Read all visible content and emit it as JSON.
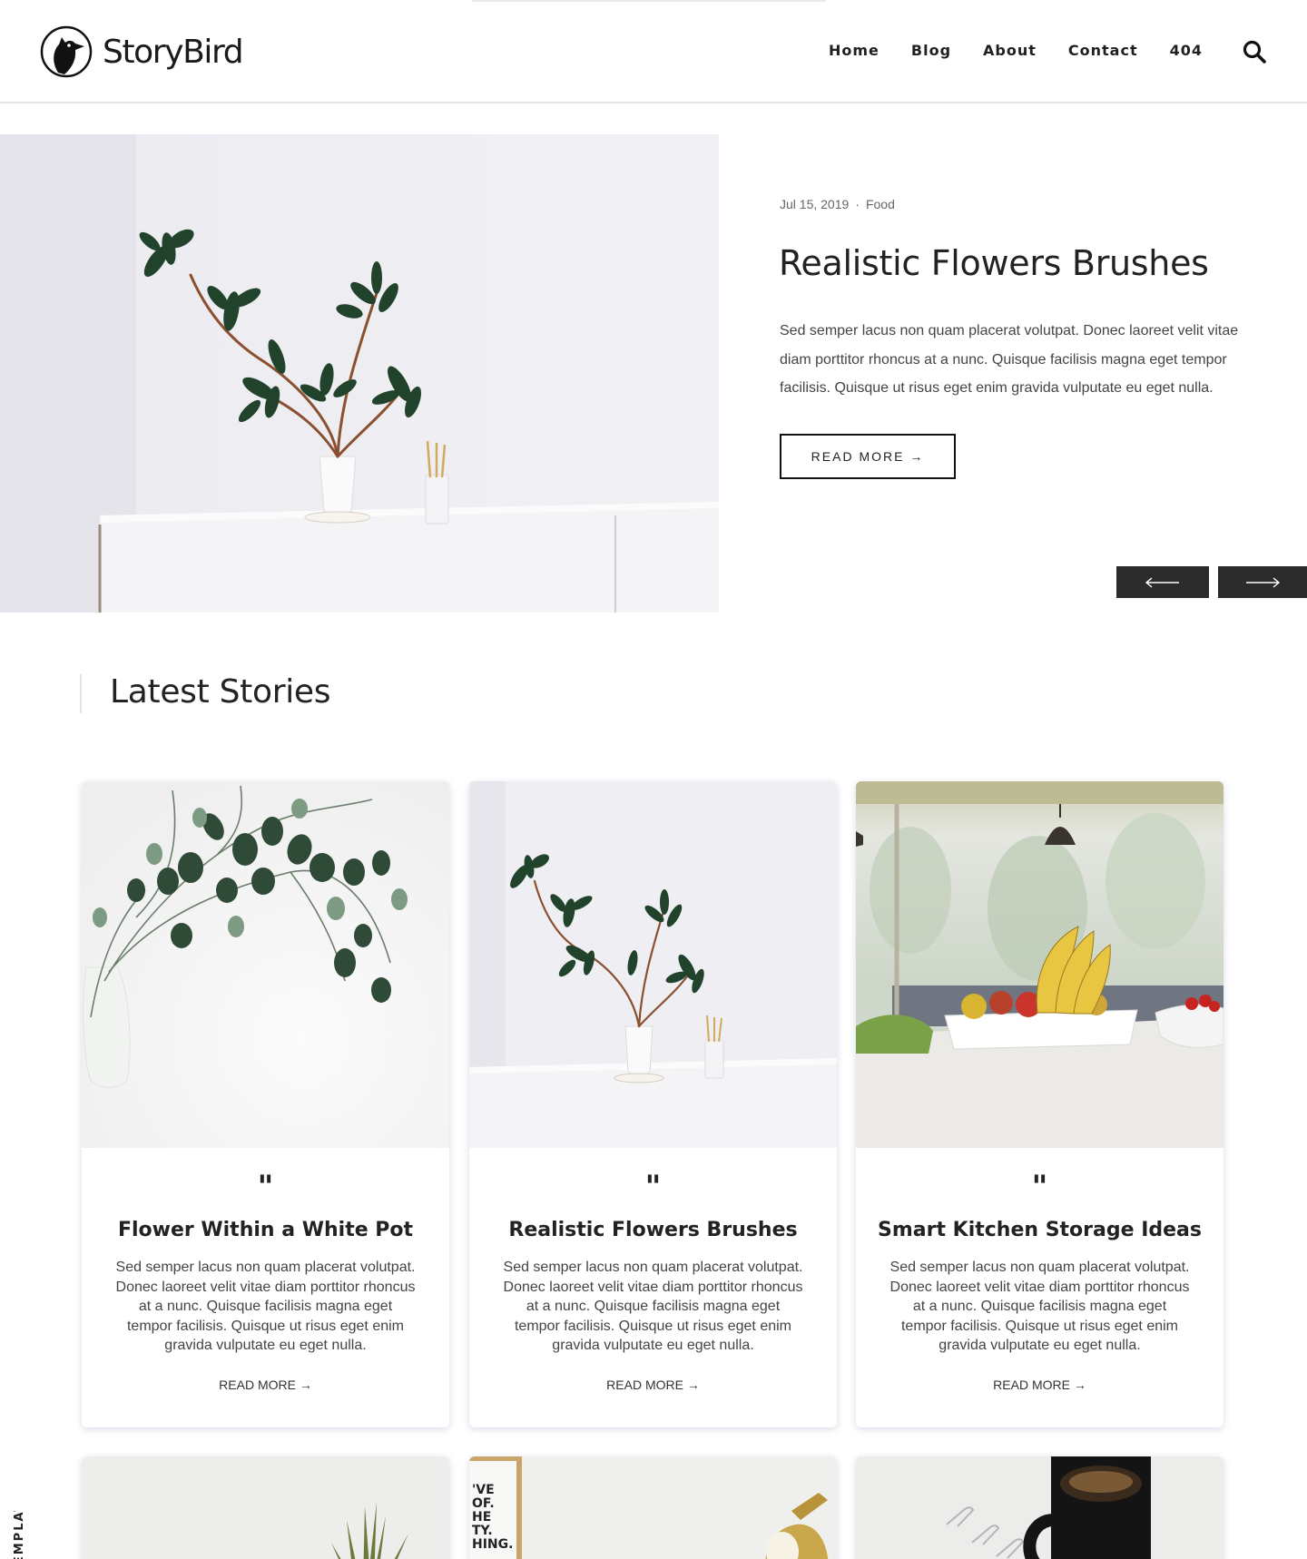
{
  "brand": {
    "name": "StoryBird"
  },
  "nav": {
    "items": [
      {
        "label": "Home"
      },
      {
        "label": "Blog"
      },
      {
        "label": "About"
      },
      {
        "label": "Contact"
      },
      {
        "label": "404"
      }
    ],
    "search_icon": "search-icon"
  },
  "hero": {
    "date": "Jul 15, 2019",
    "separator": "·",
    "category": "Food",
    "title": "Realistic Flowers Brushes",
    "excerpt": "Sed semper lacus non quam placerat volutpat. Donec laoreet velit vitae diam porttitor rhoncus at a nunc. Quisque facilisis magna eget tempor facilisis. Quisque ut risus eget enim gravida vulputate eu eget nulla.",
    "read_more": "READ MORE →",
    "prev_icon": "arrow-left-icon",
    "next_icon": "arrow-right-icon"
  },
  "latest": {
    "heading": "Latest Stories",
    "cards": [
      {
        "quote": "\"",
        "title": "Flower Within a White Pot",
        "excerpt": "Sed semper lacus non quam placerat volutpat. Donec laoreet velit vitae diam porttitor rhoncus at a nunc. Quisque facilisis magna eget tempor facilisis. Quisque ut risus eget enim gravida vulputate eu eget nulla.",
        "read_more": "READ MORE →"
      },
      {
        "quote": "\"",
        "title": "Realistic Flowers Brushes",
        "excerpt": "Sed semper lacus non quam placerat volutpat. Donec laoreet velit vitae diam porttitor rhoncus at a nunc. Quisque facilisis magna eget tempor facilisis. Quisque ut risus eget enim gravida vulputate eu eget nulla.",
        "read_more": "READ MORE →"
      },
      {
        "quote": "\"",
        "title": "Smart Kitchen Storage Ideas",
        "excerpt": "Sed semper lacus non quam placerat volutpat. Donec laoreet velit vitae diam porttitor rhoncus at a nunc. Quisque facilisis magna eget tempor facilisis. Quisque ut risus eget enim gravida vulputate eu eget nulla.",
        "read_more": "READ MORE →"
      }
    ]
  },
  "side_label": "TEMPLATE",
  "poster_text": "'VE OF. HE TY. HING."
}
